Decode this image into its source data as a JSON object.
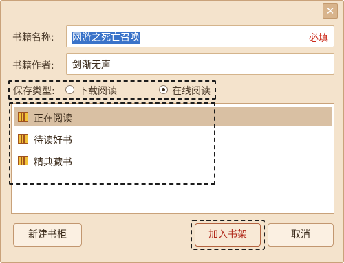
{
  "dialog": {
    "close_glyph": "✕"
  },
  "form": {
    "book_name_label": "书籍名称:",
    "book_name_value": "网游之死亡召唤",
    "required_text": "必填",
    "author_label": "书籍作者:",
    "author_value": "剑渐无声",
    "save_type_label": "保存类型:",
    "save_type_options": [
      {
        "label": "下载阅读",
        "checked": false
      },
      {
        "label": "在线阅读",
        "checked": true
      }
    ]
  },
  "shelves": [
    {
      "label": "正在阅读",
      "active": true
    },
    {
      "label": "待读好书",
      "active": false
    },
    {
      "label": "精典藏书",
      "active": false
    }
  ],
  "buttons": {
    "new_shelf": "新建书柜",
    "add_to_shelf": "加入书架",
    "cancel": "取消"
  },
  "colors": {
    "dialog_bg": "#f4e3cc",
    "selection": "#3a73c9",
    "required": "#cc2a1a",
    "active_item": "#d9c0a3"
  }
}
